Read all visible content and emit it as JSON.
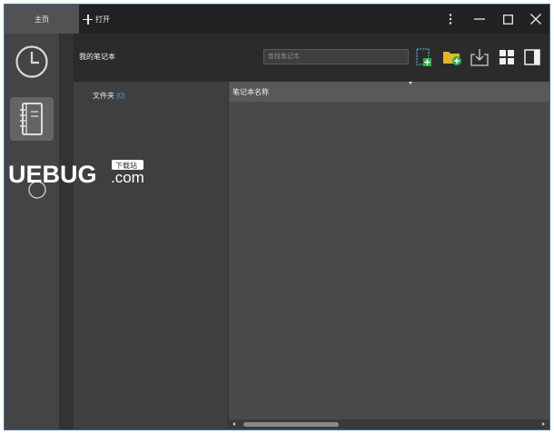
{
  "titlebar": {
    "home_tab": "主页",
    "open_tab": "打开",
    "controls": [
      "more-vertical-icon",
      "minimize-icon",
      "maximize-icon",
      "close-icon"
    ]
  },
  "rail": {
    "items": [
      {
        "icon": "clock-icon",
        "active": false
      },
      {
        "icon": "notebook-icon",
        "active": true
      }
    ]
  },
  "main": {
    "title": "我的笔记本",
    "search": {
      "placeholder": "查找笔记本",
      "value": ""
    },
    "toolbar": [
      "new-notebook-icon",
      "new-folder-icon",
      "import-icon",
      "grid-view-icon",
      "panel-toggle-icon"
    ]
  },
  "folders": {
    "label": "文件夹",
    "count": "(0)"
  },
  "list": {
    "column_header": "笔记本名称"
  },
  "watermark": {
    "brand": "UEBUG",
    "tag": "下载站",
    "domain": ".com"
  },
  "colors": {
    "accent_green": "#2db04a",
    "folder_yellow": "#e3b52a",
    "count_blue": "#4a9fd8",
    "window_border": "#4a6ea0"
  }
}
